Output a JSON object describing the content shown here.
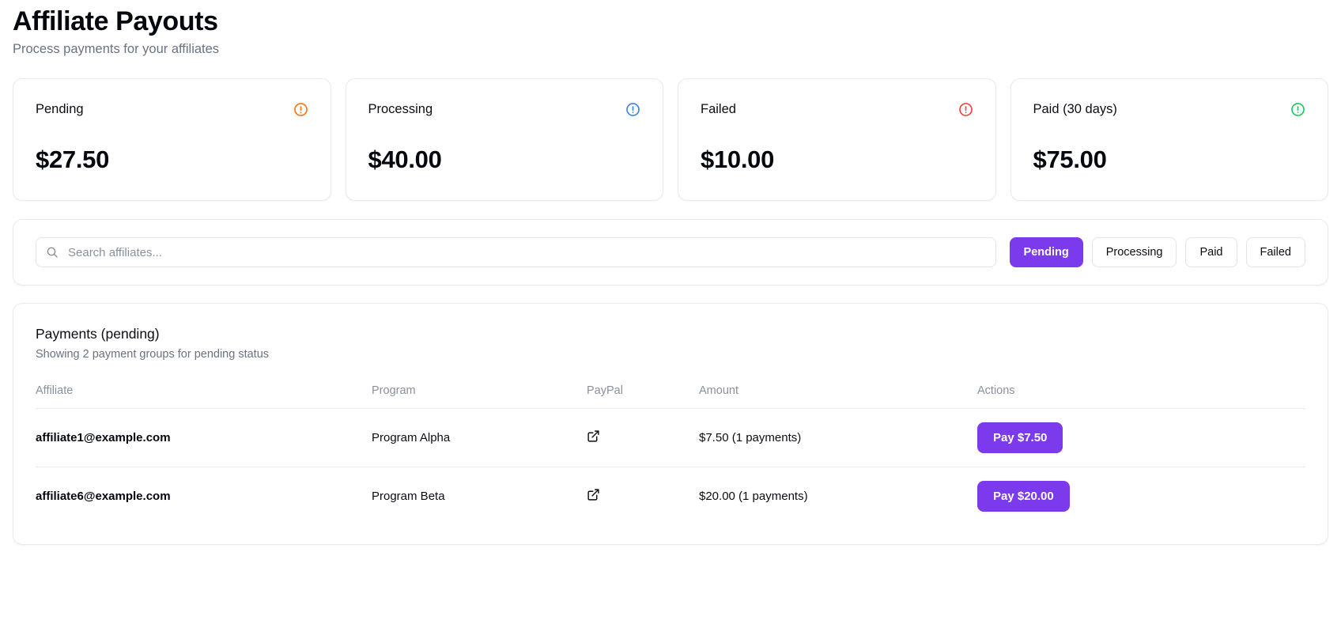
{
  "header": {
    "title": "Affiliate Payouts",
    "subtitle": "Process payments for your affiliates"
  },
  "stats": [
    {
      "label": "Pending",
      "value": "$27.50",
      "icon": "alert-circle-icon",
      "color": "#f97316"
    },
    {
      "label": "Processing",
      "value": "$40.00",
      "icon": "alert-circle-icon",
      "color": "#3b82f6"
    },
    {
      "label": "Failed",
      "value": "$10.00",
      "icon": "alert-circle-icon",
      "color": "#ef4444"
    },
    {
      "label": "Paid (30 days)",
      "value": "$75.00",
      "icon": "alert-circle-icon",
      "color": "#22c55e"
    }
  ],
  "filters": {
    "search": {
      "placeholder": "Search affiliates...",
      "value": "",
      "icon": "search-icon"
    },
    "buttons": [
      {
        "label": "Pending",
        "active": true
      },
      {
        "label": "Processing",
        "active": false
      },
      {
        "label": "Paid",
        "active": false
      },
      {
        "label": "Failed",
        "active": false
      }
    ],
    "active_color": "#7c3aed"
  },
  "table": {
    "title": "Payments (pending)",
    "caption": "Showing 2 payment groups for pending status",
    "columns": [
      "Affiliate",
      "Program",
      "PayPal",
      "Amount",
      "Actions"
    ],
    "rows": [
      {
        "affiliate": "affiliate1@example.com",
        "program": "Program Alpha",
        "paypal_icon": "external-link-icon",
        "amount": "$7.50 (1 payments)",
        "action_label": "Pay $7.50"
      },
      {
        "affiliate": "affiliate6@example.com",
        "program": "Program Beta",
        "paypal_icon": "external-link-icon",
        "amount": "$20.00 (1 payments)",
        "action_label": "Pay $20.00"
      }
    ]
  }
}
